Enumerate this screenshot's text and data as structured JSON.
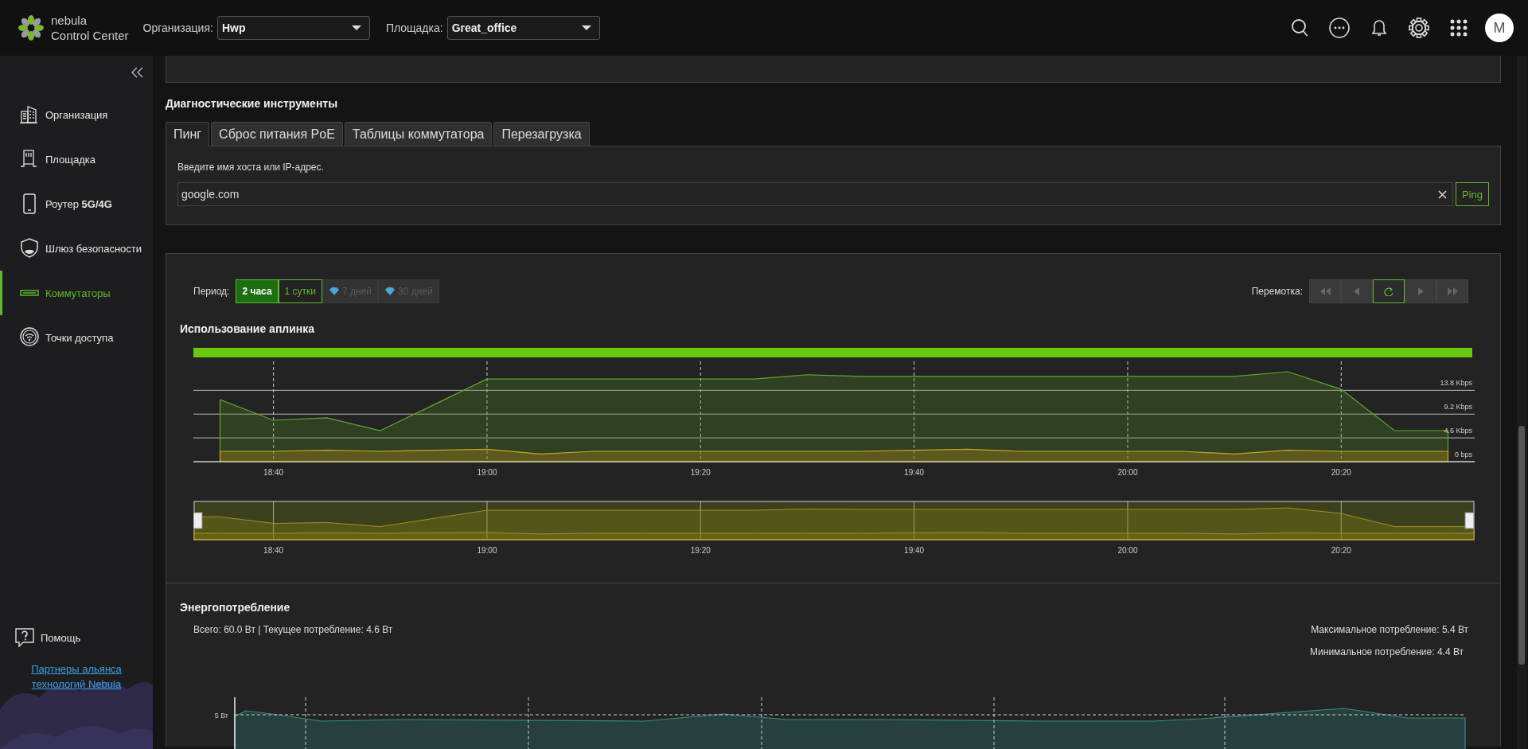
{
  "header": {
    "logo_line1": "nebula",
    "logo_line2": "Control Center",
    "org_label": "Организация:",
    "org_value": "Hwp",
    "site_label": "Площадка:",
    "site_value": "Great_office",
    "avatar": "M"
  },
  "sidebar": {
    "items": [
      {
        "label": "Организация",
        "selected": false
      },
      {
        "label": "Площадка",
        "selected": false
      },
      {
        "label": "Роутер **5G/4G**",
        "selected": false
      },
      {
        "label": "Шлюз безопасности",
        "selected": false
      },
      {
        "label": "Коммутаторы",
        "selected": true
      },
      {
        "label": "Точки доступа",
        "selected": false
      }
    ],
    "help": "Помощь",
    "partners_link": "Партнеры альянса технологий Nebula"
  },
  "diagnostics": {
    "title": "Диагностические инструменты",
    "tabs": [
      {
        "label": "Пинг",
        "selected": true
      },
      {
        "label": "Сброс питания PoE",
        "selected": false
      },
      {
        "label": "Таблицы коммутатора",
        "selected": false
      },
      {
        "label": "Перезагрузка",
        "selected": false
      }
    ],
    "hint": "Введите имя хоста или IP-адрес.",
    "host_value": "google.com",
    "ping_button": "Ping"
  },
  "uplink": {
    "period_label": "Период:",
    "periods": [
      {
        "label": "2 часа",
        "selected": true,
        "disabled": false,
        "premium": false
      },
      {
        "label": "1 сутки",
        "selected": false,
        "disabled": false,
        "premium": false
      },
      {
        "label": "7 дней",
        "selected": false,
        "disabled": true,
        "premium": true
      },
      {
        "label": "30 дней",
        "selected": false,
        "disabled": true,
        "premium": true
      }
    ],
    "rewind_label": "Перемотка:",
    "rewind_buttons": [
      {
        "kind": "first",
        "disabled": true
      },
      {
        "kind": "prev",
        "disabled": true
      },
      {
        "kind": "refresh",
        "disabled": false
      },
      {
        "kind": "next",
        "disabled": true
      },
      {
        "kind": "last",
        "disabled": true
      }
    ],
    "title": "Использование аплинка",
    "chart_data": {
      "type": "area",
      "categories": [
        null,
        "18:40",
        null,
        null,
        null,
        "19:00",
        null,
        null,
        null,
        "19:20",
        null,
        null,
        null,
        "19:40",
        null,
        null,
        null,
        "20:00",
        null,
        null,
        null,
        "20:20",
        null,
        null
      ],
      "series": [
        {
          "color": "#5fa82c",
          "values": [
            12,
            8,
            8.5,
            6,
            11,
            16,
            16,
            16,
            16,
            16,
            16,
            16.8,
            16.5,
            16.5,
            16.5,
            16.5,
            16.5,
            16.5,
            16.5,
            16.5,
            17.4,
            14,
            6,
            6
          ]
        },
        {
          "color": "#c9a227",
          "values": [
            2,
            2,
            2.2,
            2,
            2.2,
            2.4,
            1.5,
            2,
            2,
            2,
            2,
            2,
            2,
            2.2,
            2.4,
            2,
            2,
            2,
            2,
            1.5,
            2.2,
            2,
            2,
            2
          ]
        }
      ],
      "ylim": [
        0,
        19.4
      ],
      "grid": true,
      "yticks": [
        {
          "value": 0,
          "label": "0 bps"
        },
        {
          "value": 4.6,
          "label": "4.6 Kbps"
        },
        {
          "value": 9.2,
          "label": "9.2 Kbps"
        },
        {
          "value": 13.8,
          "label": "13.8 Kbps"
        }
      ]
    },
    "navigator_ticks": [
      "18:40",
      "19:00",
      "19:20",
      "19:40",
      "20:00",
      "20:20"
    ]
  },
  "power": {
    "title": "Энергопотребление",
    "summary": "Всего: 60.0 Вт | Текущее потребление: 4.6 Вт",
    "max": "Максимальное потребление: 5.4 Вт",
    "min": "Минимальное потребление: 4.4 Вт",
    "y_label": "5 Вт"
  }
}
